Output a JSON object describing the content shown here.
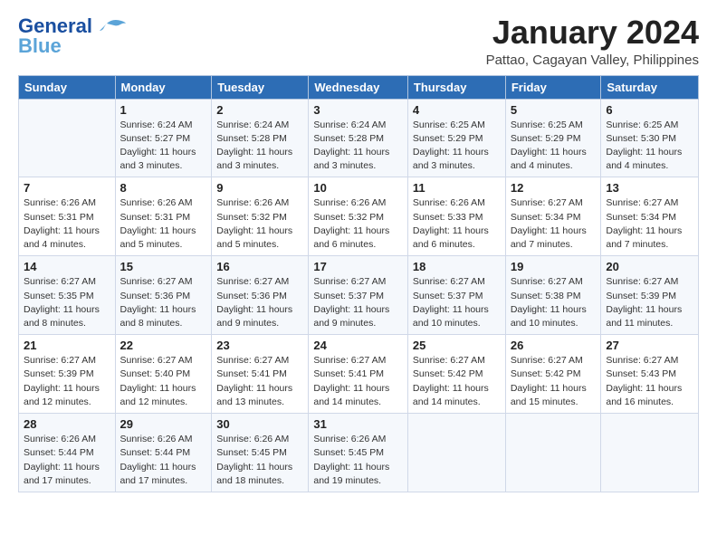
{
  "logo": {
    "line1": "General",
    "line2": "Blue"
  },
  "title": "January 2024",
  "subtitle": "Pattao, Cagayan Valley, Philippines",
  "days_of_week": [
    "Sunday",
    "Monday",
    "Tuesday",
    "Wednesday",
    "Thursday",
    "Friday",
    "Saturday"
  ],
  "weeks": [
    [
      {
        "day": "",
        "info": ""
      },
      {
        "day": "1",
        "info": "Sunrise: 6:24 AM\nSunset: 5:27 PM\nDaylight: 11 hours\nand 3 minutes."
      },
      {
        "day": "2",
        "info": "Sunrise: 6:24 AM\nSunset: 5:28 PM\nDaylight: 11 hours\nand 3 minutes."
      },
      {
        "day": "3",
        "info": "Sunrise: 6:24 AM\nSunset: 5:28 PM\nDaylight: 11 hours\nand 3 minutes."
      },
      {
        "day": "4",
        "info": "Sunrise: 6:25 AM\nSunset: 5:29 PM\nDaylight: 11 hours\nand 3 minutes."
      },
      {
        "day": "5",
        "info": "Sunrise: 6:25 AM\nSunset: 5:29 PM\nDaylight: 11 hours\nand 4 minutes."
      },
      {
        "day": "6",
        "info": "Sunrise: 6:25 AM\nSunset: 5:30 PM\nDaylight: 11 hours\nand 4 minutes."
      }
    ],
    [
      {
        "day": "7",
        "info": "Sunrise: 6:26 AM\nSunset: 5:31 PM\nDaylight: 11 hours\nand 4 minutes."
      },
      {
        "day": "8",
        "info": "Sunrise: 6:26 AM\nSunset: 5:31 PM\nDaylight: 11 hours\nand 5 minutes."
      },
      {
        "day": "9",
        "info": "Sunrise: 6:26 AM\nSunset: 5:32 PM\nDaylight: 11 hours\nand 5 minutes."
      },
      {
        "day": "10",
        "info": "Sunrise: 6:26 AM\nSunset: 5:32 PM\nDaylight: 11 hours\nand 6 minutes."
      },
      {
        "day": "11",
        "info": "Sunrise: 6:26 AM\nSunset: 5:33 PM\nDaylight: 11 hours\nand 6 minutes."
      },
      {
        "day": "12",
        "info": "Sunrise: 6:27 AM\nSunset: 5:34 PM\nDaylight: 11 hours\nand 7 minutes."
      },
      {
        "day": "13",
        "info": "Sunrise: 6:27 AM\nSunset: 5:34 PM\nDaylight: 11 hours\nand 7 minutes."
      }
    ],
    [
      {
        "day": "14",
        "info": "Sunrise: 6:27 AM\nSunset: 5:35 PM\nDaylight: 11 hours\nand 8 minutes."
      },
      {
        "day": "15",
        "info": "Sunrise: 6:27 AM\nSunset: 5:36 PM\nDaylight: 11 hours\nand 8 minutes."
      },
      {
        "day": "16",
        "info": "Sunrise: 6:27 AM\nSunset: 5:36 PM\nDaylight: 11 hours\nand 9 minutes."
      },
      {
        "day": "17",
        "info": "Sunrise: 6:27 AM\nSunset: 5:37 PM\nDaylight: 11 hours\nand 9 minutes."
      },
      {
        "day": "18",
        "info": "Sunrise: 6:27 AM\nSunset: 5:37 PM\nDaylight: 11 hours\nand 10 minutes."
      },
      {
        "day": "19",
        "info": "Sunrise: 6:27 AM\nSunset: 5:38 PM\nDaylight: 11 hours\nand 10 minutes."
      },
      {
        "day": "20",
        "info": "Sunrise: 6:27 AM\nSunset: 5:39 PM\nDaylight: 11 hours\nand 11 minutes."
      }
    ],
    [
      {
        "day": "21",
        "info": "Sunrise: 6:27 AM\nSunset: 5:39 PM\nDaylight: 11 hours\nand 12 minutes."
      },
      {
        "day": "22",
        "info": "Sunrise: 6:27 AM\nSunset: 5:40 PM\nDaylight: 11 hours\nand 12 minutes."
      },
      {
        "day": "23",
        "info": "Sunrise: 6:27 AM\nSunset: 5:41 PM\nDaylight: 11 hours\nand 13 minutes."
      },
      {
        "day": "24",
        "info": "Sunrise: 6:27 AM\nSunset: 5:41 PM\nDaylight: 11 hours\nand 14 minutes."
      },
      {
        "day": "25",
        "info": "Sunrise: 6:27 AM\nSunset: 5:42 PM\nDaylight: 11 hours\nand 14 minutes."
      },
      {
        "day": "26",
        "info": "Sunrise: 6:27 AM\nSunset: 5:42 PM\nDaylight: 11 hours\nand 15 minutes."
      },
      {
        "day": "27",
        "info": "Sunrise: 6:27 AM\nSunset: 5:43 PM\nDaylight: 11 hours\nand 16 minutes."
      }
    ],
    [
      {
        "day": "28",
        "info": "Sunrise: 6:26 AM\nSunset: 5:44 PM\nDaylight: 11 hours\nand 17 minutes."
      },
      {
        "day": "29",
        "info": "Sunrise: 6:26 AM\nSunset: 5:44 PM\nDaylight: 11 hours\nand 17 minutes."
      },
      {
        "day": "30",
        "info": "Sunrise: 6:26 AM\nSunset: 5:45 PM\nDaylight: 11 hours\nand 18 minutes."
      },
      {
        "day": "31",
        "info": "Sunrise: 6:26 AM\nSunset: 5:45 PM\nDaylight: 11 hours\nand 19 minutes."
      },
      {
        "day": "",
        "info": ""
      },
      {
        "day": "",
        "info": ""
      },
      {
        "day": "",
        "info": ""
      }
    ]
  ]
}
